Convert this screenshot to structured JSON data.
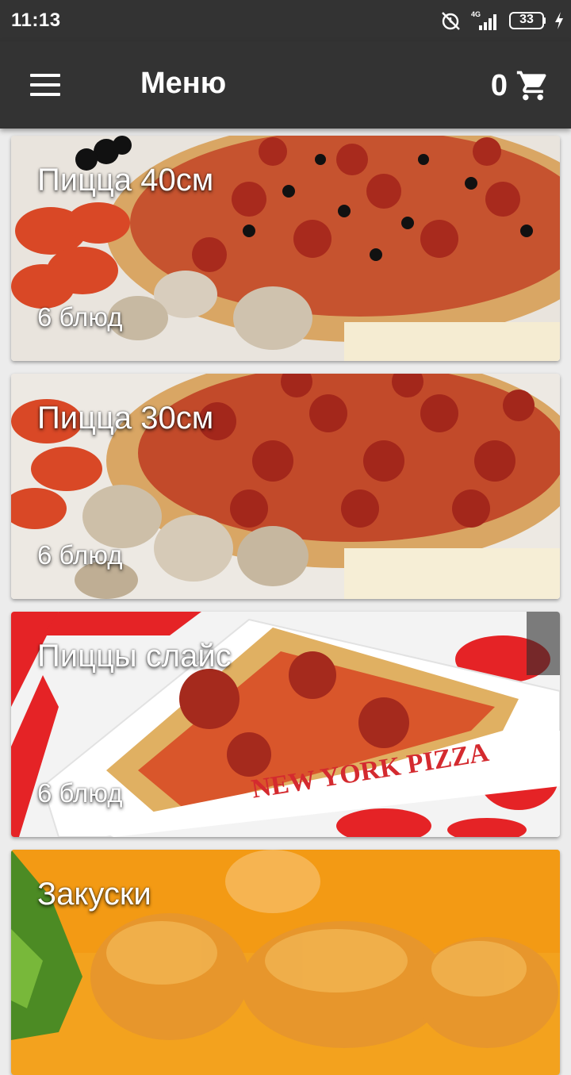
{
  "status_bar": {
    "time": "11:13",
    "network": "4G",
    "battery": "33",
    "icons": [
      "alarm-off-icon",
      "signal-icon",
      "battery-icon",
      "charging-icon"
    ]
  },
  "toolbar": {
    "title": "Меню",
    "cart_count": "0",
    "background": "#333333"
  },
  "categories": [
    {
      "name": "Пицца 40см",
      "count": "6 блюд",
      "image": "pepperoni-olive-pizza"
    },
    {
      "name": "Пицца 30см",
      "count": "6 блюд",
      "image": "pepperoni-pizza"
    },
    {
      "name": "Пиццы слайс",
      "count": "6 блюд",
      "image": "pizza-slice-box",
      "box_text": "NEW YORK PIZZA"
    },
    {
      "name": "Закуски",
      "count": "",
      "image": "fried-nuggets"
    }
  ]
}
